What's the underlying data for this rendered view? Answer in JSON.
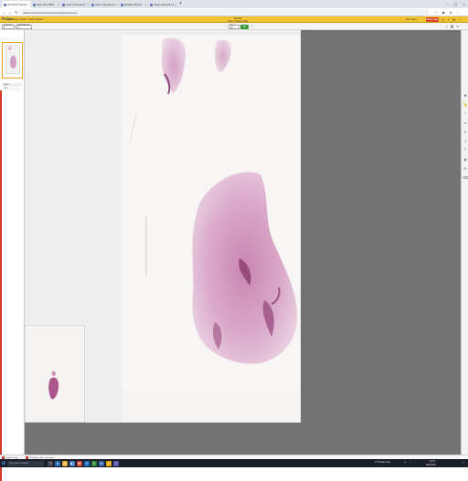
{
  "browser": {
    "tabs": [
      {
        "title": "Ver Panel Scanner"
      },
      {
        "title": "Case View 4825"
      },
      {
        "title": "Case: Documento 2"
      },
      {
        "title": "Case: Case Review"
      },
      {
        "title": "Dictation Review"
      },
      {
        "title": "Cases Approval List"
      }
    ],
    "new_tab_label": "+",
    "url": "dashboard/section/viewer/slide/default/slideview"
  },
  "app": {
    "logo": "Philips",
    "breadcrumb": "Image Viewer › Case Explorer",
    "case_title": "S5-180",
    "case_subtitle": "Slide 1 Stained H&E",
    "user": "User Name",
    "close_label": "Close Case"
  },
  "toolbar": {
    "layout_select": "Layouts ▾",
    "tools_select": "Annotations ▾",
    "zoom_value": "1x │ 2x",
    "zoom_go": "Fit"
  },
  "thumbnail": {
    "label": "Slide 1",
    "meta": "H&E"
  },
  "downloads": [
    {
      "name": "Capture 1.jpg"
    },
    {
      "name": "Pathology_slide_export.pdf"
    }
  ],
  "taskbar": {
    "search_placeholder": "Type here to search",
    "weather": "17° Mostly clear",
    "time": "10:41",
    "date": "8/22/2019"
  },
  "colors": {
    "header_accent": "#f2c230",
    "close_button": "#d9452b",
    "viewer_background": "#737373",
    "tissue_stain": "#c88db5"
  }
}
